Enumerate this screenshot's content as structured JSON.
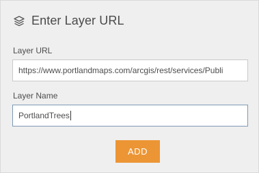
{
  "header": {
    "icon": "layers-icon",
    "title": "Enter Layer URL"
  },
  "form": {
    "url_label": "Layer URL",
    "url_value": "https://www.portlandmaps.com/arcgis/rest/services/Publi",
    "name_label": "Layer Name",
    "name_value": "PortlandTrees",
    "add_label": "ADD"
  },
  "colors": {
    "panel_bg": "#efefef",
    "accent_button": "#ec9535",
    "focused_border": "#7d98b3"
  }
}
